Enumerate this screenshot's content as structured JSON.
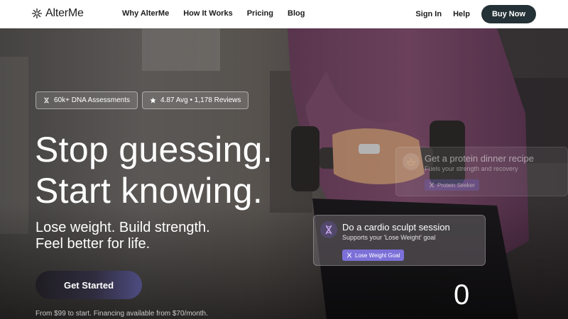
{
  "nav": {
    "brand": "AlterMe",
    "links": [
      "Why AlterMe",
      "How It Works",
      "Pricing",
      "Blog"
    ],
    "sign_in": "Sign In",
    "help": "Help",
    "buy_now": "Buy Now"
  },
  "hero": {
    "badges": [
      {
        "icon": "dna-icon",
        "text": "60k+ DNA Assessments"
      },
      {
        "icon": "star-icon",
        "text": "4.87 Avg • 1,178 Reviews"
      }
    ],
    "headline_line1": "Stop guessing.",
    "headline_line2": "Start knowing.",
    "subhead_line1": "Lose weight. Build strength.",
    "subhead_line2": "Feel better for life.",
    "cta": "Get Started",
    "fineprint": "From $99 to start. Financing available from $70/month.",
    "counter": "0"
  },
  "cards": [
    {
      "icon": "bowl-icon",
      "title": "Get a protein dinner recipe",
      "subtitle": "Fuels your strength and recovery",
      "tag": "Protein Seeker"
    },
    {
      "icon": "dna-icon",
      "title": "Do a cardio sculpt session",
      "subtitle": "Supports your 'Lose Weight' goal",
      "tag": "Lose Weight Goal"
    }
  ],
  "colors": {
    "nav_button": "#243136",
    "tag_purple": "#7c70d8",
    "text_dark": "#1c1c1c"
  }
}
